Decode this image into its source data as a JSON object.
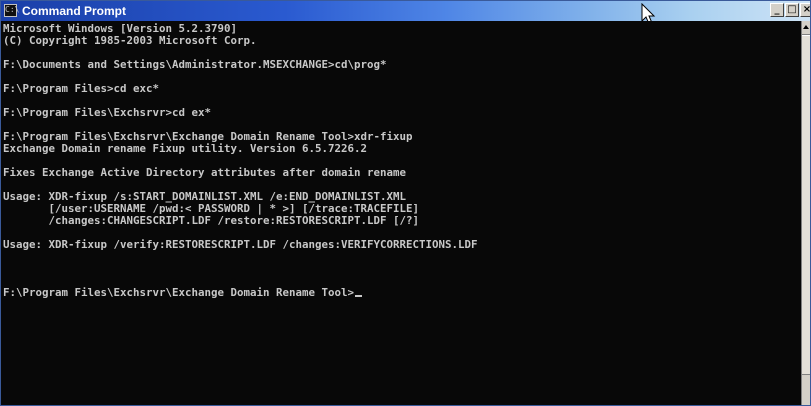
{
  "window": {
    "title": "Command Prompt",
    "icon_glyph": "C:\\",
    "buttons": {
      "minimize": "_",
      "maximize": "□",
      "close": "×"
    }
  },
  "console": {
    "lines": [
      "Microsoft Windows [Version 5.2.3790]",
      "(C) Copyright 1985-2003 Microsoft Corp.",
      "",
      "F:\\Documents and Settings\\Administrator.MSEXCHANGE>cd\\prog*",
      "",
      "F:\\Program Files>cd exc*",
      "",
      "F:\\Program Files\\Exchsrvr>cd ex*",
      "",
      "F:\\Program Files\\Exchsrvr\\Exchange Domain Rename Tool>xdr-fixup",
      "Exchange Domain rename Fixup utility. Version 6.5.7226.2",
      "",
      "Fixes Exchange Active Directory attributes after domain rename",
      "",
      "Usage: XDR-fixup /s:START_DOMAINLIST.XML /e:END_DOMAINLIST.XML",
      "       [/user:USERNAME /pwd:< PASSWORD | * >] [/trace:TRACEFILE]",
      "       /changes:CHANGESCRIPT.LDF /restore:RESTORESCRIPT.LDF [/?]",
      "",
      "Usage: XDR-fixup /verify:RESTORESCRIPT.LDF /changes:VERIFYCORRECTIONS.LDF",
      "",
      "",
      "",
      "F:\\Program Files\\Exchsrvr\\Exchange Domain Rename Tool>"
    ]
  },
  "colors": {
    "console_bg": "#080808",
    "console_fg": "#c8c8c8",
    "titlebar_start": "#1a3fa8",
    "titlebar_end": "#cfe4f6"
  },
  "icons": {
    "window_icon": "command-prompt-icon",
    "pointer": "mouse-pointer-icon"
  }
}
